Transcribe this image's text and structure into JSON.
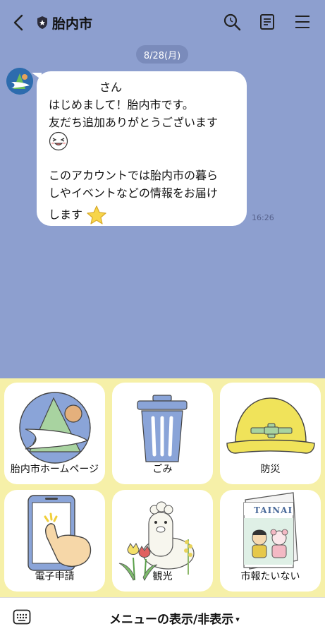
{
  "header": {
    "back_icon": "chevron-left-icon",
    "account_badge_icon": "shield-icon",
    "title": "胎内市",
    "search_icon": "search-icon",
    "notes_icon": "notes-icon",
    "menu_icon": "hamburger-menu-icon"
  },
  "chat": {
    "date": "8/28(月)",
    "message": {
      "lines": [
        "さん",
        "はじめまして！胎内市です。",
        "友だち追加ありがとうございます",
        "",
        "",
        "このアカウントでは胎内市の暮ら",
        "しやイベントなどの情報をお届け",
        "します"
      ],
      "emoji_1": "laughing-face-emoji",
      "emoji_2": "star-emoji",
      "time": "16:26"
    }
  },
  "rich_menu": {
    "items": [
      {
        "label": "胎内市ホームページ",
        "icon": "city-logo-icon"
      },
      {
        "label": "ごみ",
        "icon": "trash-can-icon"
      },
      {
        "label": "防災",
        "icon": "helmet-icon"
      },
      {
        "label": "電子申請",
        "icon": "smartphone-tap-icon"
      },
      {
        "label": "観光",
        "icon": "alpaca-tulip-icon"
      },
      {
        "label": "市報たいない",
        "icon": "newsletter-icon",
        "cover_text": "TAINAI"
      }
    ],
    "colors": {
      "background": "#f6f0a8",
      "accent_blue": "#8aa4d8",
      "accent_green": "#a8d3a0",
      "helmet_yellow": "#f0e35a"
    }
  },
  "bottom_bar": {
    "keyboard_icon": "keyboard-icon",
    "toggle_label": "メニューの表示/非表示",
    "caret": "▾"
  }
}
